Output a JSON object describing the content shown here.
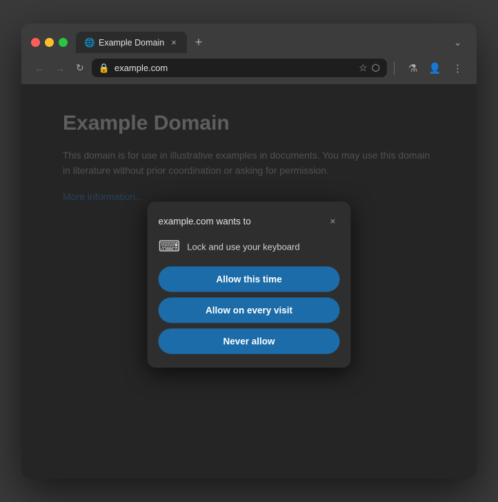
{
  "browser": {
    "tab": {
      "favicon": "🌐",
      "label": "Example Domain",
      "close": "×"
    },
    "new_tab": "+",
    "dropdown": "⌄",
    "nav": {
      "back": "←",
      "forward": "→",
      "reload": "↻"
    },
    "address": {
      "url": "example.com",
      "favicon": "🔒"
    },
    "toolbar": {
      "star": "☆",
      "extensions": "⬡",
      "flask": "⚗",
      "account": "👤",
      "more": "⋮"
    }
  },
  "webpage": {
    "title": "Example Domain",
    "body": "This domain is for use in illustrative examples in documents. You may use this domain in literature without prior coordination or asking for permission.",
    "link": "More information..."
  },
  "dialog": {
    "title": "example.com wants to",
    "close": "×",
    "permission_icon": "⌨",
    "permission_text": "Lock and use your keyboard",
    "buttons": {
      "allow_this_time": "Allow this time",
      "allow_every_visit": "Allow on every visit",
      "never_allow": "Never allow"
    }
  }
}
